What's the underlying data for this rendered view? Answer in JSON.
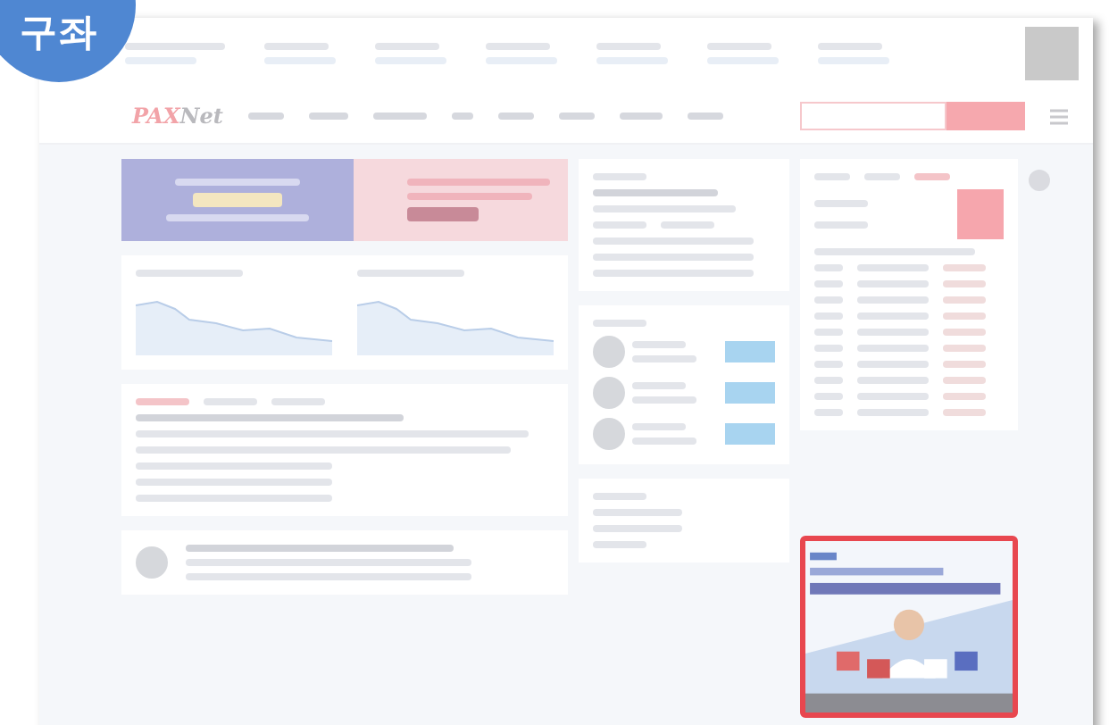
{
  "badge": {
    "label": "구좌"
  },
  "site": {
    "logo_parts": [
      "PAX",
      "Net"
    ]
  },
  "ad_slot": {
    "highlighted": true,
    "kind": "picture"
  }
}
